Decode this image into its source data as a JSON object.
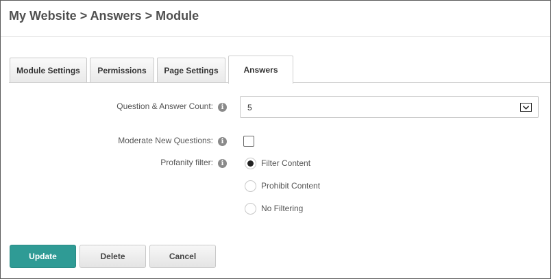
{
  "breadcrumb": "My Website > Answers > Module",
  "tabs": [
    {
      "label": "Module Settings",
      "active": false
    },
    {
      "label": "Permissions",
      "active": false
    },
    {
      "label": "Page Settings",
      "active": false
    },
    {
      "label": "Answers",
      "active": true
    }
  ],
  "form": {
    "qa_count": {
      "label": "Question & Answer Count:",
      "value": "5"
    },
    "moderate": {
      "label": "Moderate New Questions:",
      "checked": false
    },
    "profanity": {
      "label": "Profanity filter:",
      "options": [
        "Filter Content",
        "Prohibit Content",
        "No Filtering"
      ],
      "selected": "Filter Content"
    }
  },
  "info_icon_glyph": "i",
  "buttons": {
    "update": "Update",
    "delete": "Delete",
    "cancel": "Cancel"
  },
  "colors": {
    "primary_button": "#2f9b95"
  }
}
